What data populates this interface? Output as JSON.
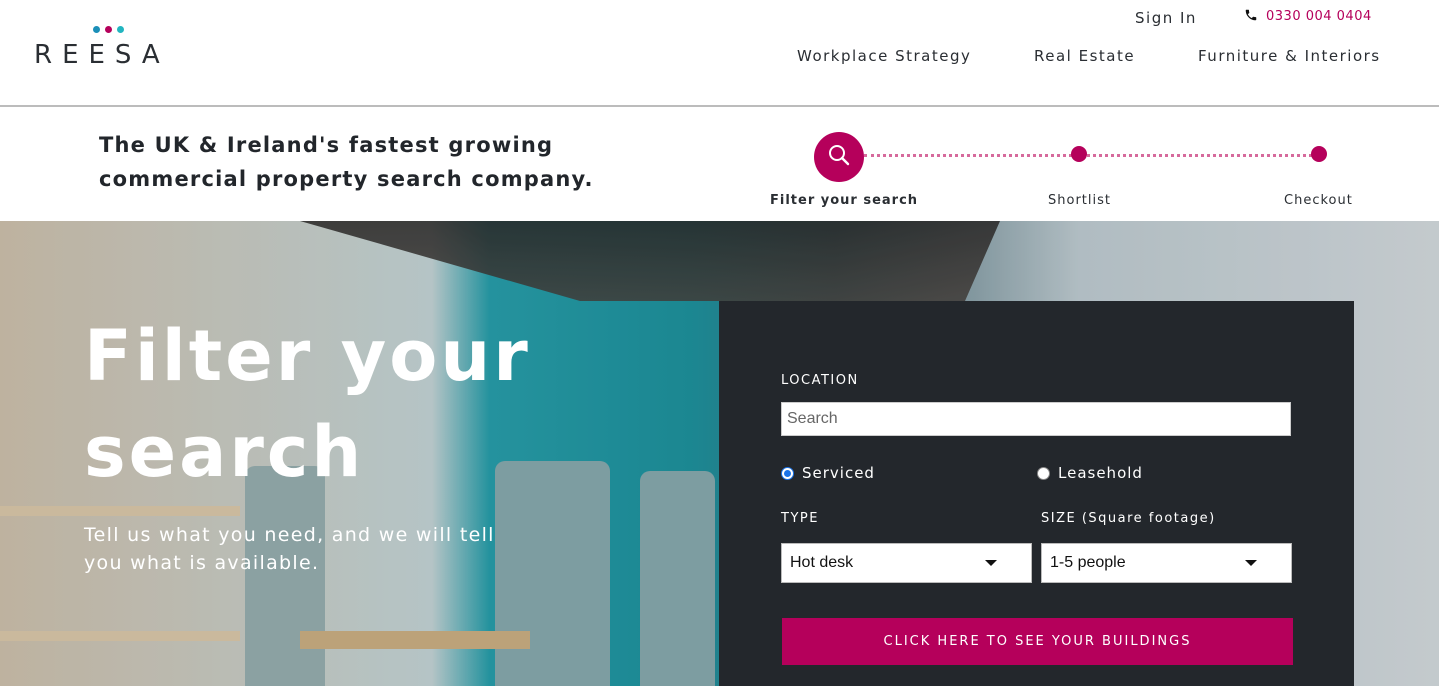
{
  "brand": {
    "logo_text": "REESA",
    "dot_colors": [
      "#1b8fb8",
      "#b5005b",
      "#22b5c0"
    ],
    "accent": "#b5005b"
  },
  "header": {
    "signin_label": "Sign In",
    "phone_icon": "phone-icon",
    "phone_number": "0330 004 0404",
    "nav": [
      "Workplace Strategy",
      "Real Estate",
      "Furniture & Interiors"
    ]
  },
  "band": {
    "tagline": "The UK & Ireland's fastest growing commercial property search company.",
    "steps": [
      {
        "label": "Filter your search",
        "icon": "search-icon",
        "active": true
      },
      {
        "label": "Shortlist",
        "active": false
      },
      {
        "label": "Checkout",
        "active": false
      }
    ]
  },
  "hero": {
    "title": "Filter your search",
    "subtitle": "Tell us what you need, and we will tell you what is available."
  },
  "filter": {
    "location_label": "LOCATION",
    "search_placeholder": "Search",
    "search_value": "",
    "options": [
      {
        "label": "Serviced",
        "checked": true
      },
      {
        "label": "Leasehold",
        "checked": false
      }
    ],
    "type_label": "TYPE",
    "type_value": "Hot desk",
    "size_label": "SIZE (Square footage)",
    "size_value": "1-5 people",
    "cta_label": "CLICK HERE TO SEE YOUR BUILDINGS"
  },
  "colors": {
    "panel_bg": "#23272c",
    "cta_bg": "#b5005b"
  }
}
